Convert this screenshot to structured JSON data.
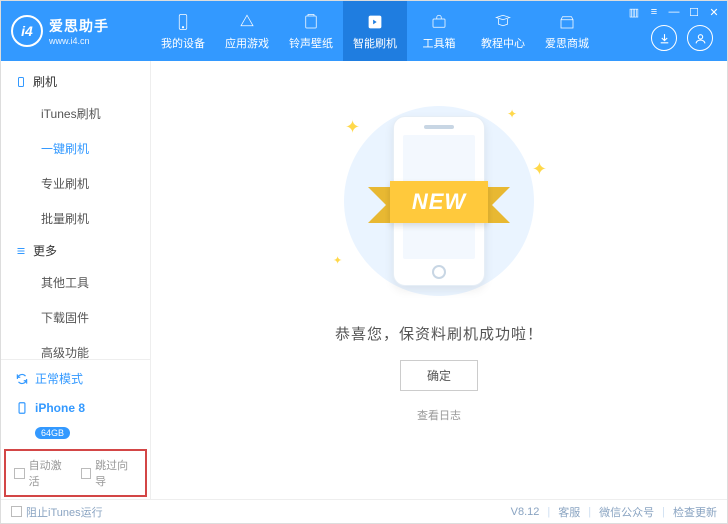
{
  "brand": {
    "name": "爱思助手",
    "site": "www.i4.cn",
    "logo_text": "i4"
  },
  "nav": [
    {
      "id": "device",
      "label": "我的设备"
    },
    {
      "id": "apps",
      "label": "应用游戏"
    },
    {
      "id": "ring",
      "label": "铃声壁纸"
    },
    {
      "id": "flash",
      "label": "智能刷机"
    },
    {
      "id": "tools",
      "label": "工具箱"
    },
    {
      "id": "tutorial",
      "label": "教程中心"
    },
    {
      "id": "mall",
      "label": "爱思商城"
    }
  ],
  "sidebar": {
    "sections": [
      {
        "title": "刷机",
        "items": [
          "iTunes刷机",
          "一键刷机",
          "专业刷机",
          "批量刷机"
        ],
        "active_index": 1
      },
      {
        "title": "更多",
        "items": [
          "其他工具",
          "下载固件",
          "高级功能"
        ],
        "active_index": -1
      }
    ],
    "mode": "正常模式",
    "device": {
      "name": "iPhone 8",
      "storage": "64GB"
    },
    "options": {
      "auto_activate": "自动激活",
      "skip_guide": "跳过向导"
    }
  },
  "main": {
    "ribbon": "NEW",
    "success_text": "恭喜您，保资料刷机成功啦！",
    "ok_button": "确定",
    "view_log": "查看日志"
  },
  "footer": {
    "block_itunes": "阻止iTunes运行",
    "version": "V8.12",
    "links": [
      "客服",
      "微信公众号",
      "检查更新"
    ]
  }
}
